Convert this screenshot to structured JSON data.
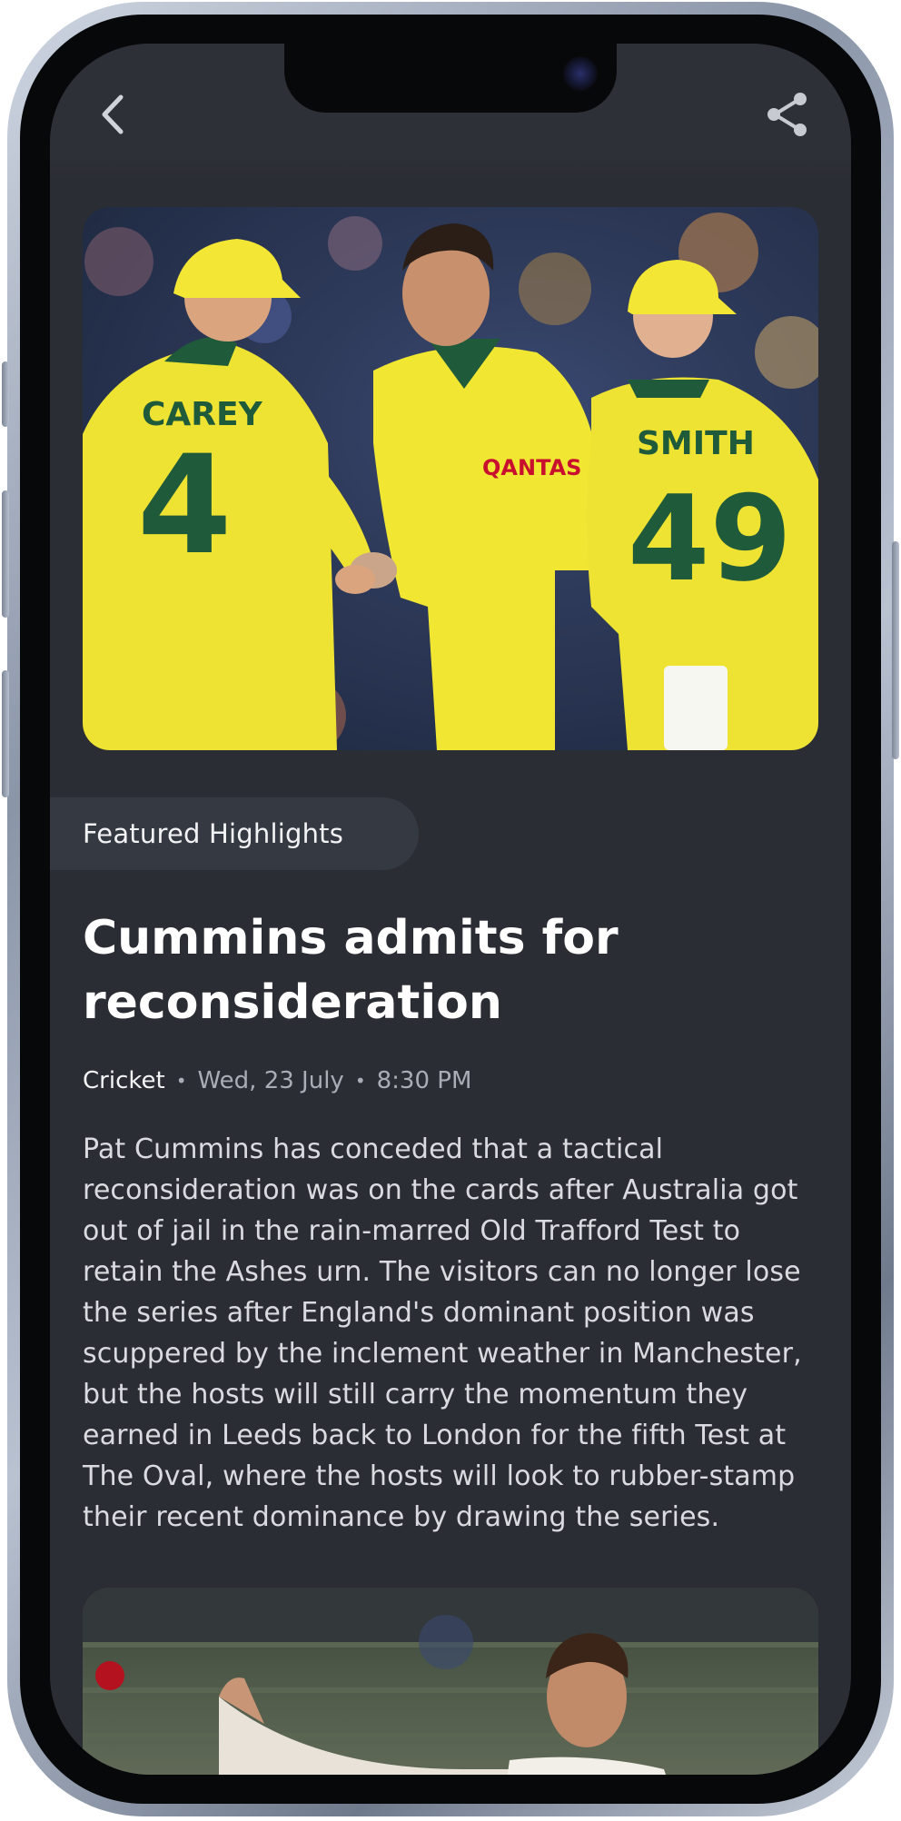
{
  "header": {
    "back_icon": "chevron-left-icon",
    "share_icon": "share-icon"
  },
  "hero_image": {
    "alt": "Australian cricket players in yellow kits shaking hands",
    "player_left": {
      "name": "CAREY",
      "number": "4"
    },
    "player_right": {
      "name": "SMITH",
      "number": "49"
    },
    "sponsor": "QANTAS"
  },
  "article": {
    "tag": "Featured Highlights",
    "title": "Cummins admits for reconsideration",
    "category": "Cricket",
    "date": "Wed, 23 July",
    "time": "8:30 PM",
    "body": "Pat Cummins has conceded that a tactical reconsideration was on the cards after Australia got out of jail in the rain-marred Old Trafford Test to retain the Ashes urn. The visitors can no longer lose the series after England's dominant position was scuppered by the inclement weather in Manchester, but the hosts will still carry the momentum they earned in Leeds back to London for the fifth Test at The Oval, where the hosts will look to rubber-stamp their recent dominance by drawing the series."
  },
  "colors": {
    "background": "#2a2d33",
    "tag_bg": "#353a42",
    "kit_yellow": "#f3e635",
    "kit_green": "#1f5a3a"
  }
}
